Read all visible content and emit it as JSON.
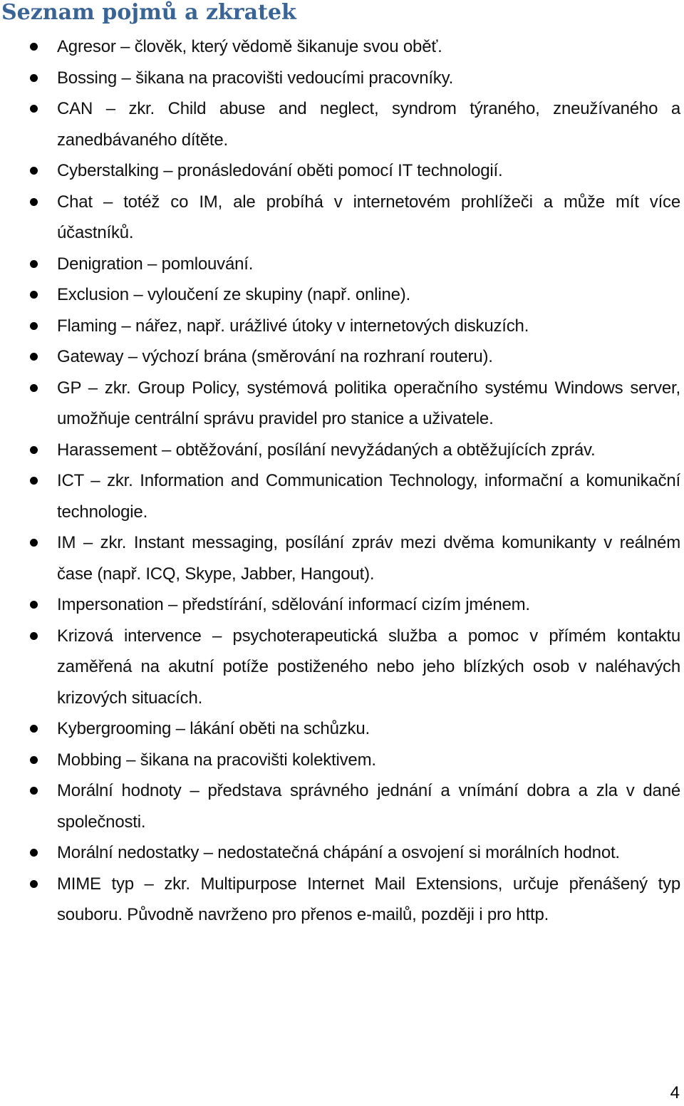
{
  "title": "Seznam pojmů a zkratek",
  "items": [
    {
      "text": "Agresor – člověk, který vědomě šikanuje svou oběť."
    },
    {
      "text": "Bossing – šikana na pracovišti vedoucími pracovníky."
    },
    {
      "text": "CAN – zkr. Child abuse and neglect, syndrom týraného, zneužívaného a zanedbávaného dítěte."
    },
    {
      "text": "Cyberstalking – pronásledování oběti pomocí IT technologií."
    },
    {
      "text": "Chat – totéž co IM, ale probíhá v internetovém prohlížeči a může mít více účastníků."
    },
    {
      "text": "Denigration – pomlouvání."
    },
    {
      "text": "Exclusion – vyloučení ze skupiny (např. online)."
    },
    {
      "text": "Flaming – nářez, např. urážlivé útoky v internetových diskuzích."
    },
    {
      "text": "Gateway – výchozí brána (směrování na rozhraní routeru)."
    },
    {
      "text": "GP – zkr. Group Policy, systémová politika operačního systému Windows server, umožňuje centrální správu pravidel pro stanice a uživatele."
    },
    {
      "text": "Harassement – obtěžování, posílání nevyžádaných a obtěžujících zpráv."
    },
    {
      "text": "ICT – zkr. Information and Communication Technology, informační a komunikační technologie."
    },
    {
      "text": "IM – zkr. Instant messaging, posílání zpráv mezi dvěma komunikanty v reálném čase (např. ICQ, Skype, Jabber, Hangout)."
    },
    {
      "text": "Impersonation – předstírání, sdělování informací cizím jménem."
    },
    {
      "text": "Krizová intervence – psychoterapeutická služba a pomoc v přímém kontaktu zaměřená na akutní potíže postiženého nebo jeho blízkých osob v naléhavých krizových situacích."
    },
    {
      "text": "Kybergrooming – lákání oběti na schůzku."
    },
    {
      "text": "Mobbing – šikana na pracovišti kolektivem."
    },
    {
      "text": "Morální hodnoty – představa správného jednání a vnímání dobra a zla v dané společnosti."
    },
    {
      "text": "Morální nedostatky – nedostatečná chápání a osvojení si morálních hodnot."
    },
    {
      "text": "MIME typ – zkr. Multipurpose Internet Mail Extensions, určuje přenášený typ souboru. Původně navrženo pro přenos e-mailů, později i pro http."
    }
  ],
  "page_number": "4"
}
